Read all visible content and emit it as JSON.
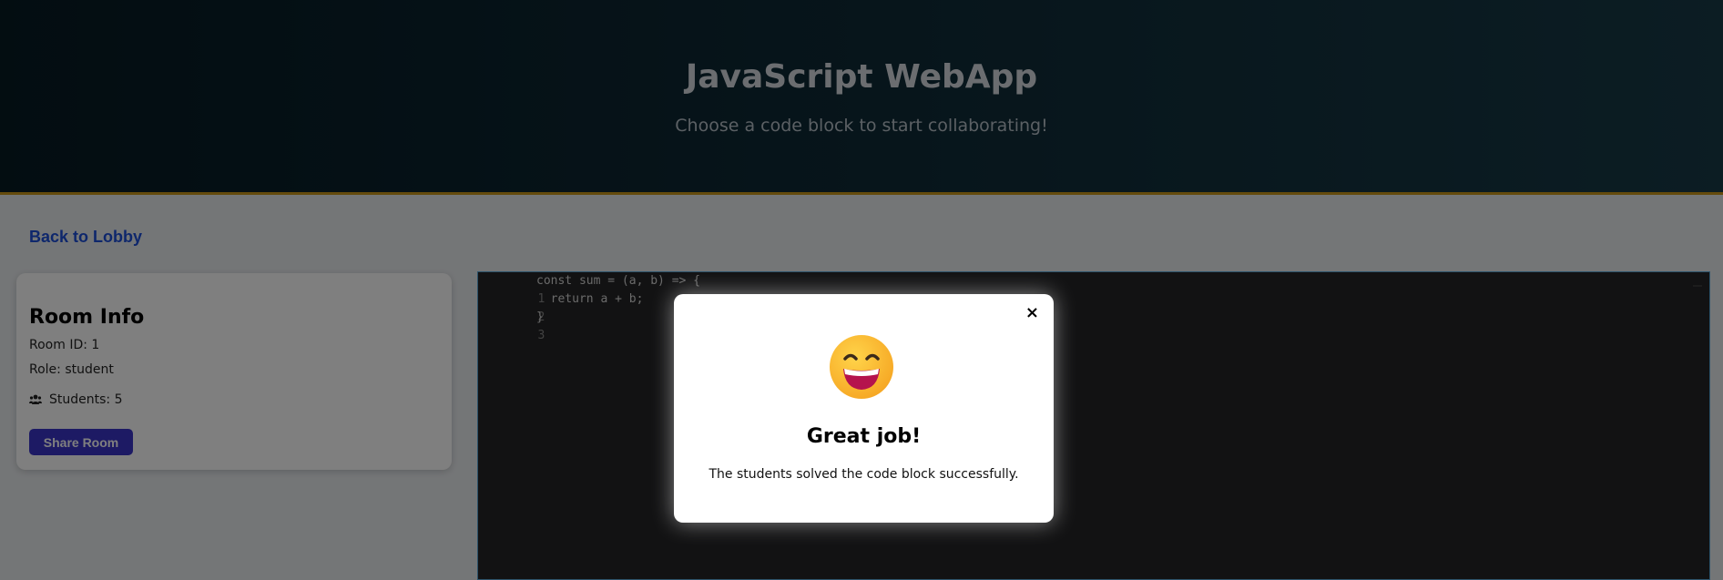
{
  "header": {
    "title": "JavaScript WebApp",
    "subtitle": "Choose a code block to start collaborating!"
  },
  "nav": {
    "back_label": "Back to Lobby"
  },
  "room": {
    "title": "Room Info",
    "room_id": "Room ID: 1",
    "role": "Role: student",
    "students": "Students: 5",
    "share_label": "Share Room",
    "icons": {
      "students": "users-icon"
    }
  },
  "editor": {
    "lines": [
      {
        "num": "1"
      },
      {
        "num": "2"
      },
      {
        "num": "3"
      }
    ],
    "code_text": "const sum = (a, b) => {\n  return a + b;\n}"
  },
  "modal": {
    "emoji": "grinning-face-icon",
    "title": "Great job!",
    "message": "The students solved the code block successfully.",
    "close_label": "×"
  },
  "colors": {
    "accent": "#3b35c9",
    "link": "#1d4fd8",
    "header_border": "#c8961b"
  }
}
